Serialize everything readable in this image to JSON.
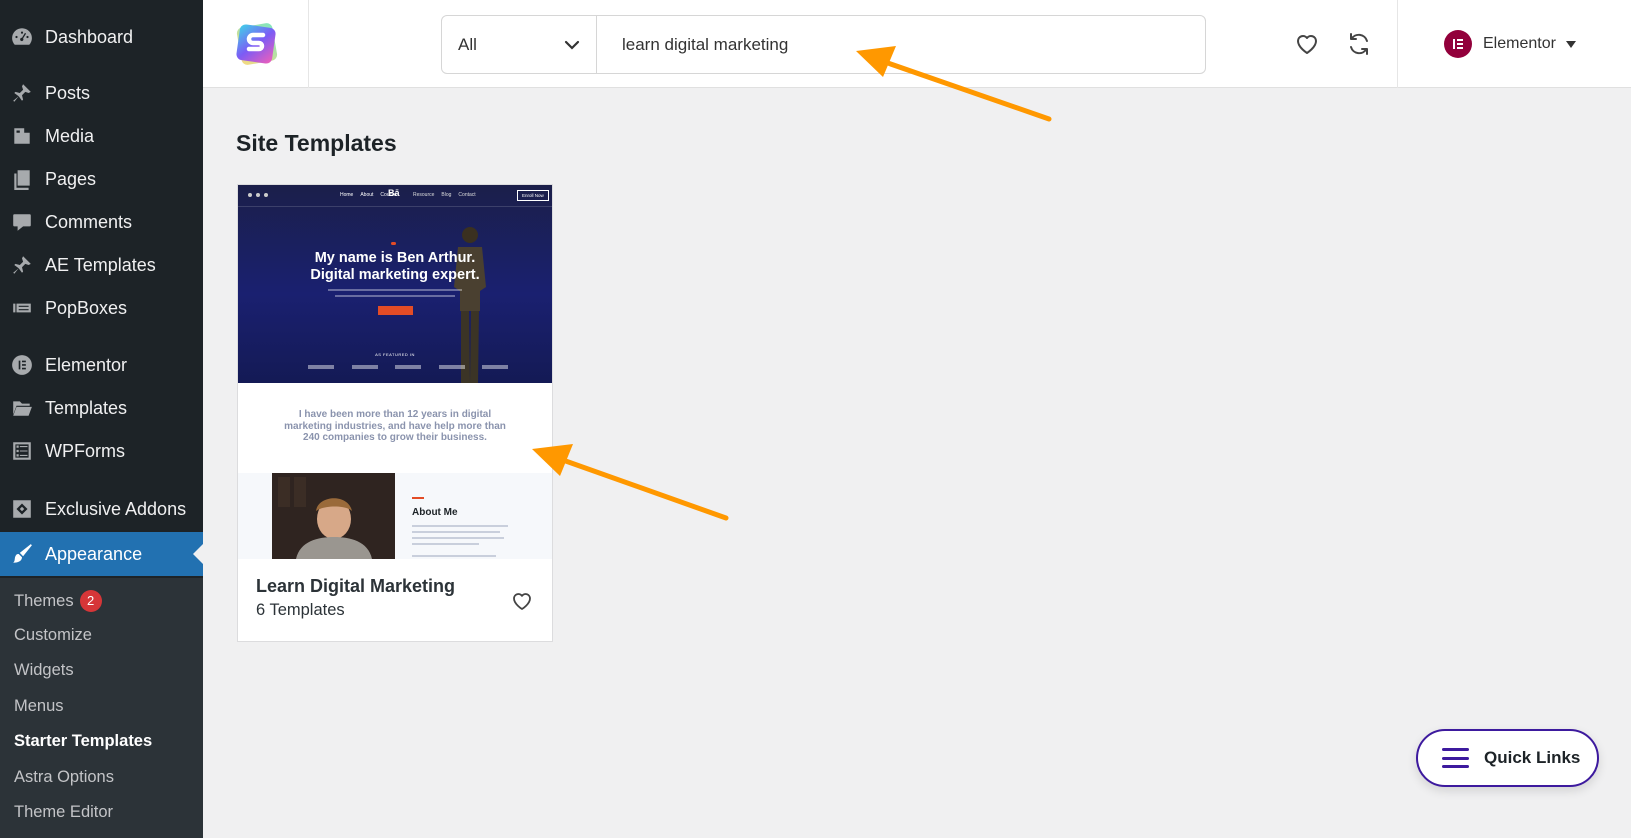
{
  "sidebar": {
    "items": [
      {
        "label": "Dashboard",
        "icon": "dashboard-icon"
      },
      {
        "label": "Posts",
        "icon": "pushpin-icon"
      },
      {
        "label": "Media",
        "icon": "media-icon"
      },
      {
        "label": "Pages",
        "icon": "pages-icon"
      },
      {
        "label": "Comments",
        "icon": "comment-icon"
      },
      {
        "label": "AE Templates",
        "icon": "pushpin-icon"
      },
      {
        "label": "PopBoxes",
        "icon": "list-icon"
      },
      {
        "label": "Elementor",
        "icon": "elementor-icon"
      },
      {
        "label": "Templates",
        "icon": "folder-icon"
      },
      {
        "label": "WPForms",
        "icon": "form-icon"
      },
      {
        "label": "Exclusive Addons",
        "icon": "diamond-icon"
      },
      {
        "label": "Appearance",
        "icon": "paintbrush-icon",
        "active": true
      }
    ],
    "submenu": [
      {
        "label": "Themes",
        "badge": "2"
      },
      {
        "label": "Customize"
      },
      {
        "label": "Widgets"
      },
      {
        "label": "Menus"
      },
      {
        "label": "Starter Templates",
        "current": true
      },
      {
        "label": "Astra Options"
      },
      {
        "label": "Theme Editor"
      }
    ]
  },
  "header": {
    "search_filter": "All",
    "search_value": "learn digital marketing",
    "user_name": "Elementor"
  },
  "main": {
    "section_title": "Site Templates",
    "card": {
      "title": "Learn Digital Marketing",
      "subtitle": "6 Templates",
      "preview": {
        "nav_links": [
          "Home",
          "About",
          "Course"
        ],
        "nav_brand": "Bā",
        "nav_links_right": [
          "Resource",
          "Blog",
          "Contact"
        ],
        "nav_button": "Enroll Now",
        "headline_line1": "My name is Ben Arthur.",
        "headline_line2": "Digital marketing expert.",
        "featured_label": "AS FEATURED IN",
        "intro_text": "I have been more than 12 years in digital marketing industries, and have help more than 240 companies to grow their business.",
        "about_heading": "About Me"
      }
    }
  },
  "quick_links": {
    "label": "Quick Links"
  },
  "colors": {
    "sidebar_bg": "#1d2327",
    "submenu_bg": "#2c3338",
    "active": "#2271b1",
    "badge": "#d63638",
    "arrow": "#ff9800",
    "quick_links_border": "#3d1a9e"
  }
}
